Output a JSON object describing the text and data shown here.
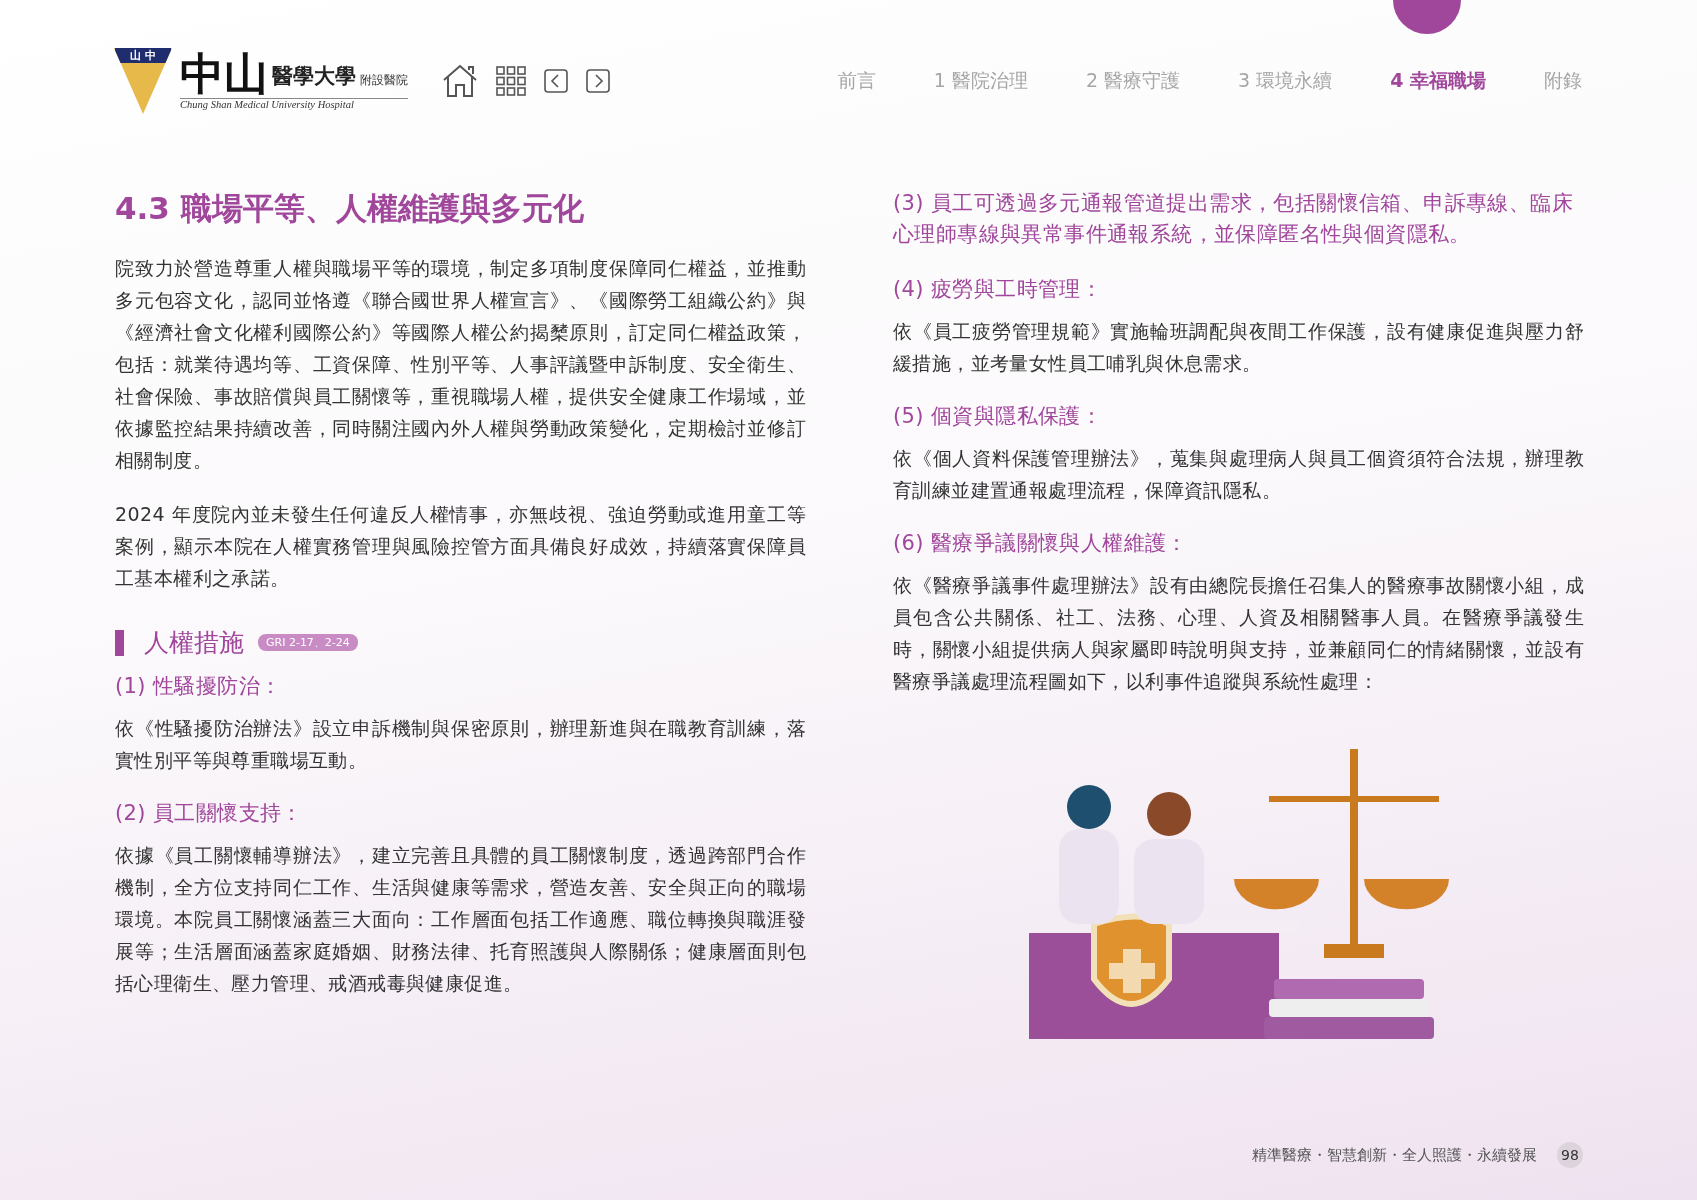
{
  "logo": {
    "emblem_text": "山 中",
    "name_large": "中山",
    "name": "醫學大學",
    "suffix": "附設醫院",
    "english": "Chung Shan Medical University Hospital"
  },
  "nav_tabs": [
    {
      "label": "前言",
      "selected": false
    },
    {
      "label": "1 醫院治理",
      "selected": false
    },
    {
      "label": "2 醫療守護",
      "selected": false
    },
    {
      "label": "3 環境永續",
      "selected": false
    },
    {
      "label": "4 幸福職場",
      "selected": true
    },
    {
      "label": "附錄",
      "selected": false
    }
  ],
  "left_column": {
    "title": "4.3 職場平等、人權維護與多元化",
    "paragraphs": [
      "院致力於營造尊重人權與職場平等的環境，制定多項制度保障同仁權益，並推動多元包容文化，認同並恪遵《聯合國世界人權宣言》、《國際勞工組織公約》與《經濟社會文化權利國際公約》等國際人權公約揭櫫原則，訂定同仁權益政策，包括：就業待遇均等、工資保障、性別平等、人事評議暨申訴制度、安全衛生、社會保險、事故賠償與員工關懷等，重視職場人權，提供安全健康工作場域，並依據監控結果持續改善，同時關注國內外人權與勞動政策變化，定期檢討並修訂相關制度。",
      "2024 年度院內並未發生任何違反人權情事，亦無歧視、強迫勞動或進用童工等案例，顯示本院在人權實務管理與風險控管方面具備良好成效，持續落實保障員工基本權利之承諾。"
    ],
    "subsection": {
      "title": "人權措施",
      "badge": "GRI 2-17、2-24"
    },
    "items": [
      {
        "heading": "(1) 性騷擾防治：",
        "body": "依《性騷擾防治辦法》設立申訴機制與保密原則，辦理新進與在職教育訓練，落實性別平等與尊重職場互動。"
      },
      {
        "heading": "(2) 員工關懷支持：",
        "body": "依據《員工關懷輔導辦法》，建立完善且具體的員工關懷制度，透過跨部門合作機制，全方位支持同仁工作、生活與健康等需求，營造友善、安全與正向的職場環境。本院員工關懷涵蓋三大面向：工作層面包括工作適應、職位轉換與職涯發展等；生活層面涵蓋家庭婚姻、財務法律、托育照護與人際關係；健康層面則包括心理衛生、壓力管理、戒酒戒毒與健康促進。"
      }
    ]
  },
  "right_column": {
    "items": [
      {
        "heading": "(3) 員工可透過多元通報管道提出需求，包括關懷信箱、申訴專線、臨床心理師專線與異常事件通報系統，並保障匿名性與個資隱私。"
      },
      {
        "heading": "(4) 疲勞與工時管理：",
        "body": "依《員工疲勞管理規範》實施輪班調配與夜間工作保護，設有健康促進與壓力舒緩措施，並考量女性員工哺乳與休息需求。"
      },
      {
        "heading": "(5) 個資與隱私保護：",
        "body": "依《個人資料保護管理辦法》，蒐集與處理病人與員工個資須符合法規，辦理教育訓練並建置通報處理流程，保障資訊隱私。"
      },
      {
        "heading": "(6) 醫療爭議關懷與人權維護：",
        "body": "依《醫療爭議事件處理辦法》設有由總院長擔任召集人的醫療事故關懷小組，成員包含公共關係、社工、法務、心理、人資及相關醫事人員。在醫療爭議發生時，關懷小組提供病人與家屬即時說明與支持，並兼顧同仁的情緒關懷，並設有醫療爭議處理流程圖如下，以利事件追蹤與系統性處理："
      }
    ]
  },
  "footer": {
    "slogan": "精準醫療・智慧創新・全人照護・永續發展",
    "page_number": "98"
  }
}
